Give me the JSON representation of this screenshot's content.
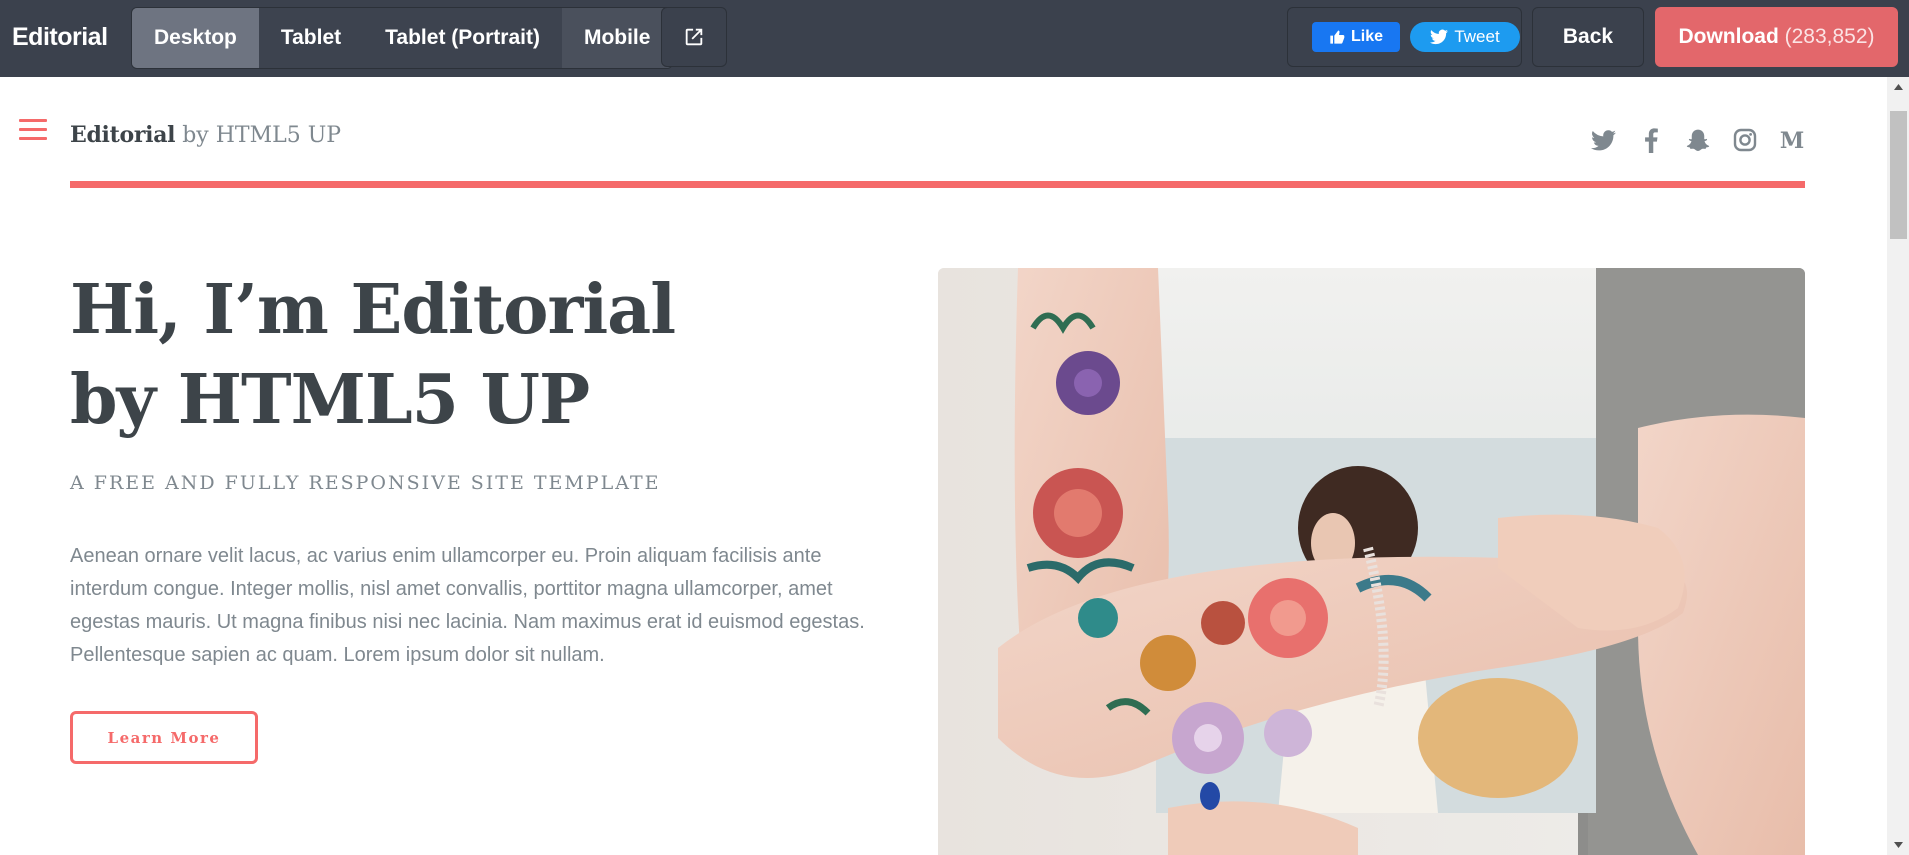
{
  "topbar": {
    "brand": "Editorial",
    "devices": [
      "Desktop",
      "Tablet",
      "Tablet (Portrait)",
      "Mobile"
    ],
    "active_device": "Desktop",
    "facebook_like": "Like",
    "twitter_tweet": "Tweet",
    "back": "Back",
    "download_label": "Download",
    "download_count": "(283,852)"
  },
  "site": {
    "logo_name": "Editorial",
    "logo_by": "by HTML5 UP",
    "social_icons": [
      "twitter-icon",
      "facebook-icon",
      "snapchat-icon",
      "instagram-icon",
      "medium-icon"
    ],
    "accent_color": "#f56a6a"
  },
  "banner": {
    "title_line1": "Hi, I’m Editorial",
    "title_line2": "by HTML5 UP",
    "subtitle": "A free and fully responsive site template",
    "body": "Aenean ornare velit lacus, ac varius enim ullamcorper eu. Proin aliquam facilisis ante interdum congue. Integer mollis, nisl amet convallis, porttitor magna ullamcorper, amet egestas mauris. Ut magna finibus nisi nec lacinia. Nam maximus erat id euismod egestas. Pellentesque sapien ac quam. Lorem ipsum dolor sit nullam.",
    "button": "Learn More"
  }
}
